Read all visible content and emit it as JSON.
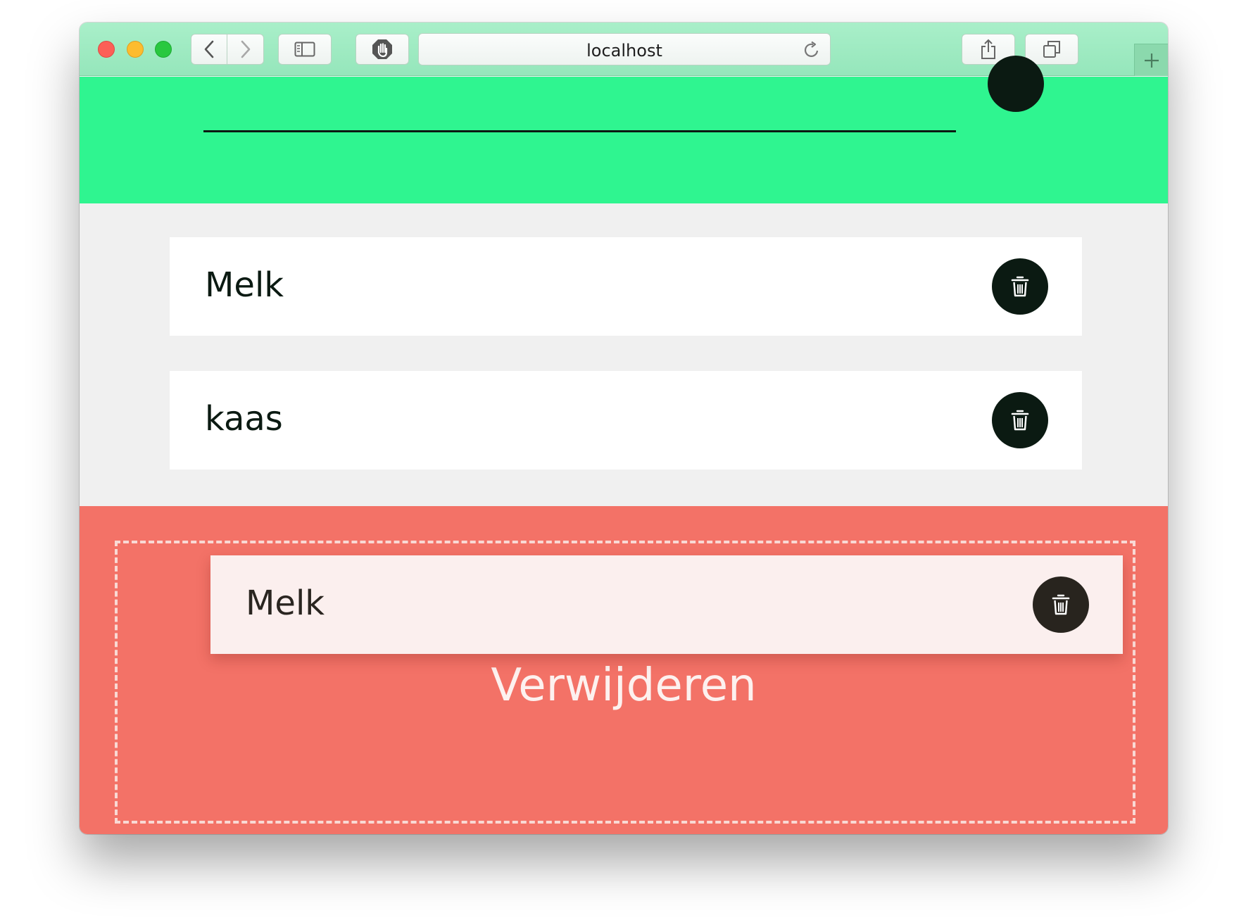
{
  "browser": {
    "address": "localhost",
    "buttons": {
      "back": "chevron-left-icon",
      "forward": "chevron-right-icon",
      "sidebar": "sidebar-icon",
      "blocker": "hand-stop-icon",
      "reload": "reload-icon",
      "share": "share-icon",
      "tabs": "tabs-icon",
      "new_tab": "plus-icon"
    }
  },
  "list": {
    "items": [
      {
        "label": "Melk",
        "action_icon": "trash-icon"
      },
      {
        "label": "kaas",
        "action_icon": "trash-icon"
      }
    ]
  },
  "delete_zone": {
    "label": "Verwijderen",
    "dragged_item": {
      "label": "Melk",
      "action_icon": "trash-icon"
    }
  },
  "colors": {
    "header": "#2ff590",
    "list_background": "#f0f0f0",
    "delete_zone": "#f37267",
    "button_dark": "#0b1a12"
  }
}
